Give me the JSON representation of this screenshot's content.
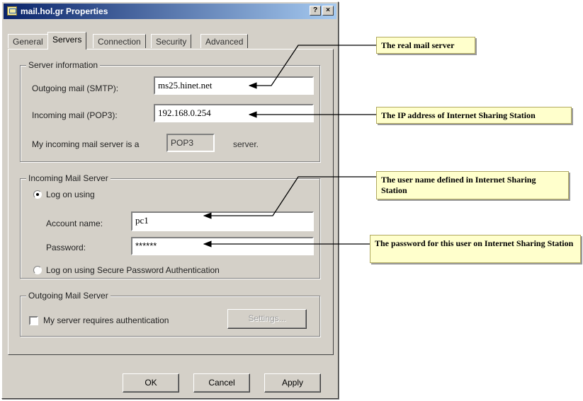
{
  "window": {
    "title": "mail.hol.gr Properties",
    "help_glyph": "?",
    "close_glyph": "×"
  },
  "tabs": [
    {
      "label": "General",
      "active": false
    },
    {
      "label": "Servers",
      "active": true
    },
    {
      "label": "Connection",
      "active": false
    },
    {
      "label": "Security",
      "active": false
    },
    {
      "label": "Advanced",
      "active": false
    }
  ],
  "server_info": {
    "group_label": "Server information",
    "outgoing_label": "Outgoing mail (SMTP):",
    "outgoing_value": "ms25.hinet.net",
    "incoming_label": "Incoming mail (POP3):",
    "incoming_value": "192.168.0.254",
    "server_type_prefix": "My incoming mail server is a",
    "server_type_value": "POP3",
    "server_type_suffix": "server."
  },
  "incoming_mail_server": {
    "group_label": "Incoming Mail Server",
    "logon_option": "Log on using",
    "account_label": "Account name:",
    "account_value": "pc1",
    "password_label": "Password:",
    "password_value": "******",
    "spa_option": "Log on using Secure Password Authentication"
  },
  "outgoing_mail_server": {
    "group_label": "Outgoing Mail Server",
    "auth_checkbox_label": "My server requires authentication",
    "settings_button": "Settings..."
  },
  "buttons": {
    "ok": "OK",
    "cancel": "Cancel",
    "apply": "Apply"
  },
  "annotations": {
    "real_mail_server": "The real mail server",
    "ip_address": "The IP address of Internet Sharing Station",
    "user_name": "The user name defined in Internet Sharing Station",
    "password": "The password for this user on Internet Sharing Station"
  },
  "colors": {
    "title_start": "#0a246a",
    "title_end": "#a6caf0",
    "callout_bg": "#ffffcc",
    "dialog_bg": "#d4d0c8"
  }
}
